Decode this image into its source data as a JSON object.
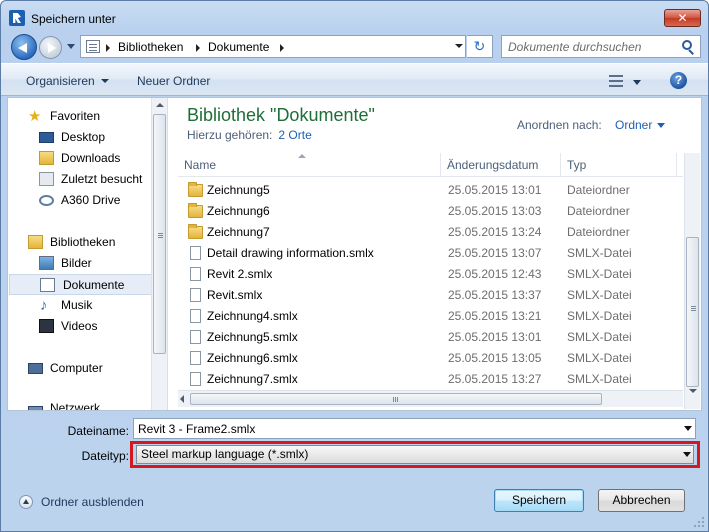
{
  "window": {
    "title": "Speichern unter",
    "close_glyph": "✕"
  },
  "address": {
    "segments": [
      "Bibliotheken",
      "Dokumente"
    ],
    "search_placeholder": "Dokumente durchsuchen"
  },
  "toolbar": {
    "organize_label": "Organisieren",
    "new_folder_label": "Neuer Ordner",
    "help_glyph": "?"
  },
  "navpane": {
    "favorites": {
      "label": "Favoriten",
      "items": [
        "Desktop",
        "Downloads",
        "Zuletzt besucht",
        "A360 Drive"
      ]
    },
    "libraries": {
      "label": "Bibliotheken",
      "items": [
        "Bilder",
        "Dokumente",
        "Musik",
        "Videos"
      ],
      "selected": "Dokumente"
    },
    "computer_label": "Computer",
    "network_label_partial": "Netzwerk"
  },
  "library": {
    "title": "Bibliothek \"Dokumente\"",
    "includes_label": "Hierzu gehören:",
    "includes_link": "2 Orte",
    "arrange_label": "Anordnen nach:",
    "arrange_value": "Ordner"
  },
  "columns": {
    "name": "Name",
    "date": "Änderungsdatum",
    "type": "Typ"
  },
  "files": [
    {
      "name": "Zeichnung5",
      "date": "25.05.2015 13:01",
      "type": "Dateiordner",
      "kind": "folder"
    },
    {
      "name": "Zeichnung6",
      "date": "25.05.2015 13:03",
      "type": "Dateiordner",
      "kind": "folder"
    },
    {
      "name": "Zeichnung7",
      "date": "25.05.2015 13:24",
      "type": "Dateiordner",
      "kind": "folder"
    },
    {
      "name": "Detail drawing information.smlx",
      "date": "25.05.2015 13:07",
      "type": "SMLX-Datei",
      "kind": "file"
    },
    {
      "name": "Revit 2.smlx",
      "date": "25.05.2015 12:43",
      "type": "SMLX-Datei",
      "kind": "file"
    },
    {
      "name": "Revit.smlx",
      "date": "25.05.2015 13:37",
      "type": "SMLX-Datei",
      "kind": "file"
    },
    {
      "name": "Zeichnung4.smlx",
      "date": "25.05.2015 13:21",
      "type": "SMLX-Datei",
      "kind": "file"
    },
    {
      "name": "Zeichnung5.smlx",
      "date": "25.05.2015 13:01",
      "type": "SMLX-Datei",
      "kind": "file"
    },
    {
      "name": "Zeichnung6.smlx",
      "date": "25.05.2015 13:05",
      "type": "SMLX-Datei",
      "kind": "file"
    },
    {
      "name": "Zeichnung7.smlx",
      "date": "25.05.2015 13:27",
      "type": "SMLX-Datei",
      "kind": "file"
    }
  ],
  "form": {
    "filename_label": "Dateiname:",
    "filename_value": "Revit 3 - Frame2.smlx",
    "filetype_label": "Dateityp:",
    "filetype_value": "Steel markup language (*.smlx)"
  },
  "footer": {
    "hide_folders_label": "Ordner ausblenden",
    "save_label": "Speichern",
    "cancel_label": "Abbrechen"
  },
  "colors": {
    "highlight": "#d3191e",
    "library_title": "#1e6e38",
    "link": "#1f5fb5"
  }
}
